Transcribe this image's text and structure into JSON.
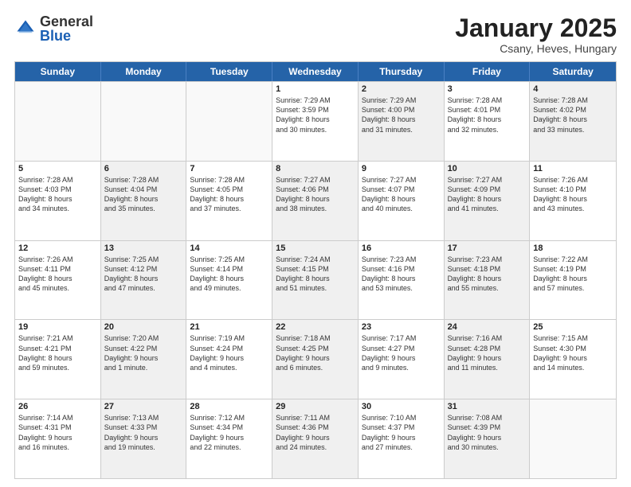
{
  "header": {
    "logo_general": "General",
    "logo_blue": "Blue",
    "month_title": "January 2025",
    "location": "Csany, Heves, Hungary"
  },
  "days_of_week": [
    "Sunday",
    "Monday",
    "Tuesday",
    "Wednesday",
    "Thursday",
    "Friday",
    "Saturday"
  ],
  "weeks": [
    [
      {
        "day": "",
        "info": "",
        "shaded": false,
        "empty": true
      },
      {
        "day": "",
        "info": "",
        "shaded": false,
        "empty": true
      },
      {
        "day": "",
        "info": "",
        "shaded": false,
        "empty": true
      },
      {
        "day": "1",
        "info": "Sunrise: 7:29 AM\nSunset: 3:59 PM\nDaylight: 8 hours\nand 30 minutes.",
        "shaded": false,
        "empty": false
      },
      {
        "day": "2",
        "info": "Sunrise: 7:29 AM\nSunset: 4:00 PM\nDaylight: 8 hours\nand 31 minutes.",
        "shaded": true,
        "empty": false
      },
      {
        "day": "3",
        "info": "Sunrise: 7:28 AM\nSunset: 4:01 PM\nDaylight: 8 hours\nand 32 minutes.",
        "shaded": false,
        "empty": false
      },
      {
        "day": "4",
        "info": "Sunrise: 7:28 AM\nSunset: 4:02 PM\nDaylight: 8 hours\nand 33 minutes.",
        "shaded": true,
        "empty": false
      }
    ],
    [
      {
        "day": "5",
        "info": "Sunrise: 7:28 AM\nSunset: 4:03 PM\nDaylight: 8 hours\nand 34 minutes.",
        "shaded": false,
        "empty": false
      },
      {
        "day": "6",
        "info": "Sunrise: 7:28 AM\nSunset: 4:04 PM\nDaylight: 8 hours\nand 35 minutes.",
        "shaded": true,
        "empty": false
      },
      {
        "day": "7",
        "info": "Sunrise: 7:28 AM\nSunset: 4:05 PM\nDaylight: 8 hours\nand 37 minutes.",
        "shaded": false,
        "empty": false
      },
      {
        "day": "8",
        "info": "Sunrise: 7:27 AM\nSunset: 4:06 PM\nDaylight: 8 hours\nand 38 minutes.",
        "shaded": true,
        "empty": false
      },
      {
        "day": "9",
        "info": "Sunrise: 7:27 AM\nSunset: 4:07 PM\nDaylight: 8 hours\nand 40 minutes.",
        "shaded": false,
        "empty": false
      },
      {
        "day": "10",
        "info": "Sunrise: 7:27 AM\nSunset: 4:09 PM\nDaylight: 8 hours\nand 41 minutes.",
        "shaded": true,
        "empty": false
      },
      {
        "day": "11",
        "info": "Sunrise: 7:26 AM\nSunset: 4:10 PM\nDaylight: 8 hours\nand 43 minutes.",
        "shaded": false,
        "empty": false
      }
    ],
    [
      {
        "day": "12",
        "info": "Sunrise: 7:26 AM\nSunset: 4:11 PM\nDaylight: 8 hours\nand 45 minutes.",
        "shaded": false,
        "empty": false
      },
      {
        "day": "13",
        "info": "Sunrise: 7:25 AM\nSunset: 4:12 PM\nDaylight: 8 hours\nand 47 minutes.",
        "shaded": true,
        "empty": false
      },
      {
        "day": "14",
        "info": "Sunrise: 7:25 AM\nSunset: 4:14 PM\nDaylight: 8 hours\nand 49 minutes.",
        "shaded": false,
        "empty": false
      },
      {
        "day": "15",
        "info": "Sunrise: 7:24 AM\nSunset: 4:15 PM\nDaylight: 8 hours\nand 51 minutes.",
        "shaded": true,
        "empty": false
      },
      {
        "day": "16",
        "info": "Sunrise: 7:23 AM\nSunset: 4:16 PM\nDaylight: 8 hours\nand 53 minutes.",
        "shaded": false,
        "empty": false
      },
      {
        "day": "17",
        "info": "Sunrise: 7:23 AM\nSunset: 4:18 PM\nDaylight: 8 hours\nand 55 minutes.",
        "shaded": true,
        "empty": false
      },
      {
        "day": "18",
        "info": "Sunrise: 7:22 AM\nSunset: 4:19 PM\nDaylight: 8 hours\nand 57 minutes.",
        "shaded": false,
        "empty": false
      }
    ],
    [
      {
        "day": "19",
        "info": "Sunrise: 7:21 AM\nSunset: 4:21 PM\nDaylight: 8 hours\nand 59 minutes.",
        "shaded": false,
        "empty": false
      },
      {
        "day": "20",
        "info": "Sunrise: 7:20 AM\nSunset: 4:22 PM\nDaylight: 9 hours\nand 1 minute.",
        "shaded": true,
        "empty": false
      },
      {
        "day": "21",
        "info": "Sunrise: 7:19 AM\nSunset: 4:24 PM\nDaylight: 9 hours\nand 4 minutes.",
        "shaded": false,
        "empty": false
      },
      {
        "day": "22",
        "info": "Sunrise: 7:18 AM\nSunset: 4:25 PM\nDaylight: 9 hours\nand 6 minutes.",
        "shaded": true,
        "empty": false
      },
      {
        "day": "23",
        "info": "Sunrise: 7:17 AM\nSunset: 4:27 PM\nDaylight: 9 hours\nand 9 minutes.",
        "shaded": false,
        "empty": false
      },
      {
        "day": "24",
        "info": "Sunrise: 7:16 AM\nSunset: 4:28 PM\nDaylight: 9 hours\nand 11 minutes.",
        "shaded": true,
        "empty": false
      },
      {
        "day": "25",
        "info": "Sunrise: 7:15 AM\nSunset: 4:30 PM\nDaylight: 9 hours\nand 14 minutes.",
        "shaded": false,
        "empty": false
      }
    ],
    [
      {
        "day": "26",
        "info": "Sunrise: 7:14 AM\nSunset: 4:31 PM\nDaylight: 9 hours\nand 16 minutes.",
        "shaded": false,
        "empty": false
      },
      {
        "day": "27",
        "info": "Sunrise: 7:13 AM\nSunset: 4:33 PM\nDaylight: 9 hours\nand 19 minutes.",
        "shaded": true,
        "empty": false
      },
      {
        "day": "28",
        "info": "Sunrise: 7:12 AM\nSunset: 4:34 PM\nDaylight: 9 hours\nand 22 minutes.",
        "shaded": false,
        "empty": false
      },
      {
        "day": "29",
        "info": "Sunrise: 7:11 AM\nSunset: 4:36 PM\nDaylight: 9 hours\nand 24 minutes.",
        "shaded": true,
        "empty": false
      },
      {
        "day": "30",
        "info": "Sunrise: 7:10 AM\nSunset: 4:37 PM\nDaylight: 9 hours\nand 27 minutes.",
        "shaded": false,
        "empty": false
      },
      {
        "day": "31",
        "info": "Sunrise: 7:08 AM\nSunset: 4:39 PM\nDaylight: 9 hours\nand 30 minutes.",
        "shaded": true,
        "empty": false
      },
      {
        "day": "",
        "info": "",
        "shaded": false,
        "empty": true
      }
    ]
  ]
}
